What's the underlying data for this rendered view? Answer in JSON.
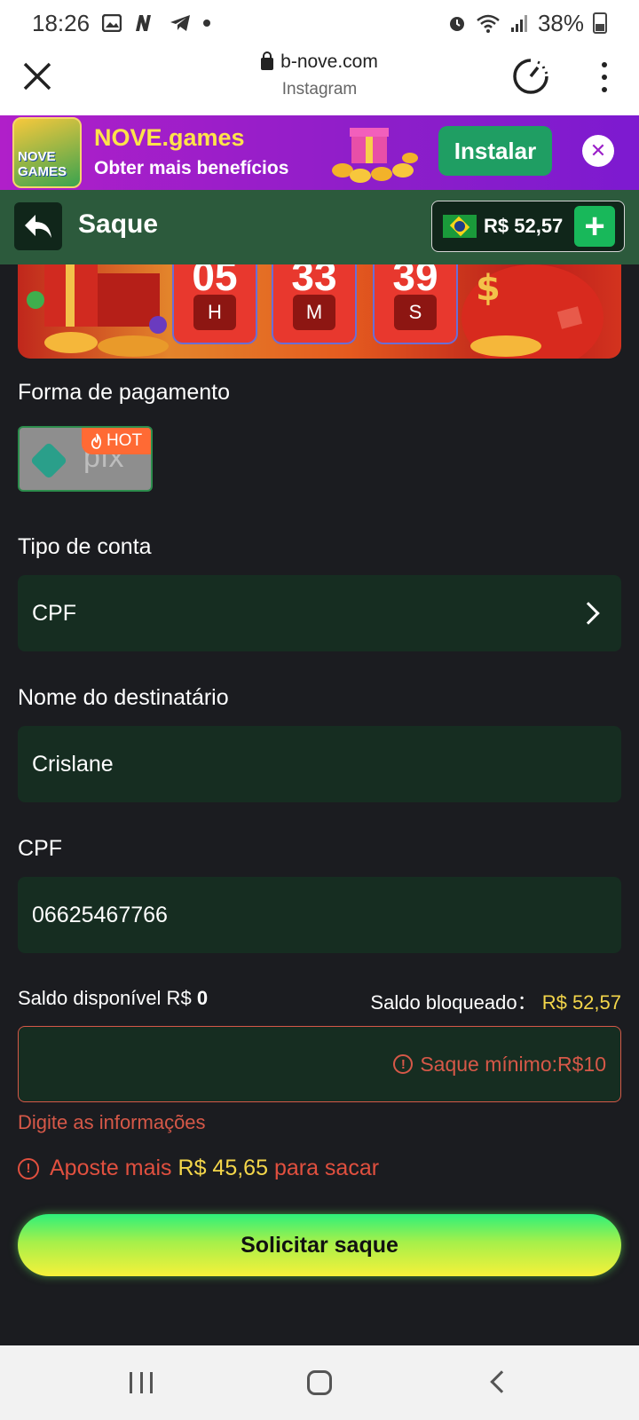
{
  "status_bar": {
    "time": "18:26",
    "battery": "38%"
  },
  "browser": {
    "url": "b-nove.com",
    "source": "Instagram"
  },
  "promo": {
    "logo_text": "NOVE GAMES",
    "title": "NOVE.games",
    "subtitle": "Obter mais benefícios",
    "install_label": "Instalar"
  },
  "header": {
    "title": "Saque",
    "balance": "R$ 52,57"
  },
  "countdown": [
    {
      "value": "05",
      "unit": "H"
    },
    {
      "value": "33",
      "unit": "M"
    },
    {
      "value": "39",
      "unit": "S"
    }
  ],
  "form": {
    "payment_label": "Forma de pagamento",
    "payment_method": {
      "name": "pix",
      "badge": "HOT"
    },
    "account_type_label": "Tipo de conta",
    "account_type_value": "CPF",
    "recipient_label": "Nome do destinatário",
    "recipient_value": "Crislane",
    "cpf_label": "CPF",
    "cpf_value": "06625467766",
    "available_label": "Saldo disponível R$",
    "available_value": "0",
    "blocked_label": "Saldo bloqueado：",
    "blocked_value": "R$ 52,57",
    "min_withdraw": "Saque mínimo:R$10",
    "error_text": "Digite as informações",
    "bet_prefix": "Aposte mais",
    "bet_amount": "R$ 45,65",
    "bet_suffix": "para sacar",
    "submit_label": "Solicitar saque"
  },
  "colors": {
    "accent_green": "#2c5a3c",
    "field_bg": "#162d21",
    "error": "#d65848",
    "highlight": "#f4d64a"
  }
}
